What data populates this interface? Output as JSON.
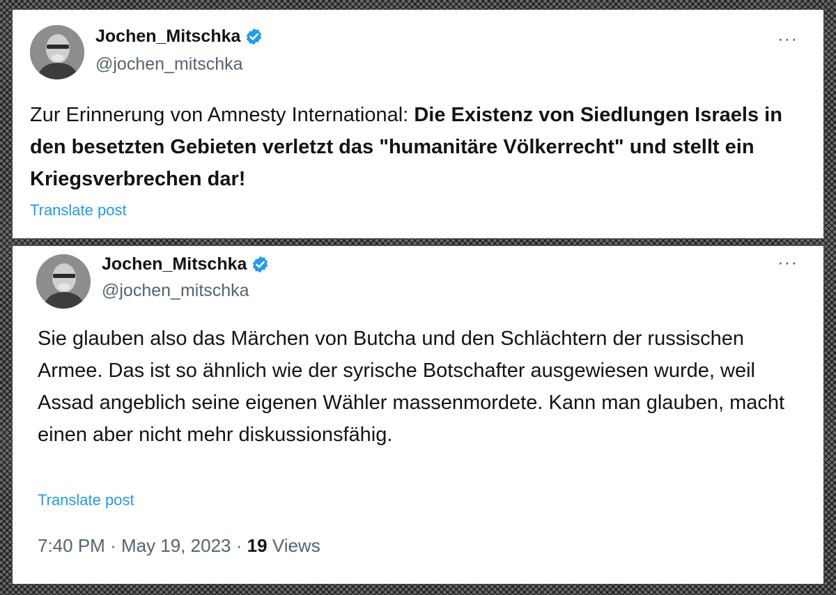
{
  "tweets": [
    {
      "author": {
        "display_name": "Jochen_Mitschka",
        "handle": "@jochen_mitschka",
        "verified": true
      },
      "text_plain": "Zur Erinnerung von Amnesty International: ",
      "text_bold": "Die Existenz von Siedlungen Israels in den besetzten Gebieten verletzt das \"humanitäre Völkerrecht\" und stellt ein Kriegsverbrechen dar!",
      "translate_label": "Translate post",
      "more_label": "···"
    },
    {
      "author": {
        "display_name": "Jochen_Mitschka",
        "handle": "@jochen_mitschka",
        "verified": true
      },
      "text_plain": "Sie glauben also das Märchen von Butcha und den Schlächtern der russischen Armee. Das ist so ähnlich wie der syrische Botschafter ausgewiesen wurde, weil Assad angeblich seine eigenen Wähler massenmordete. Kann man glauben, macht einen aber nicht mehr diskussionsfähig.",
      "translate_label": "Translate post",
      "more_label": "···",
      "meta": {
        "time": "7:40 PM",
        "separator": "·",
        "date": "May 19, 2023",
        "views_count": "19",
        "views_label": "Views"
      }
    }
  ],
  "colors": {
    "link": "#1d9bf0",
    "secondary_text": "#536471",
    "primary_text": "#0f1419",
    "verified": "#1d9bf0"
  },
  "icons": {
    "verified": "verified-badge-icon",
    "more": "more-horizontal-icon"
  }
}
